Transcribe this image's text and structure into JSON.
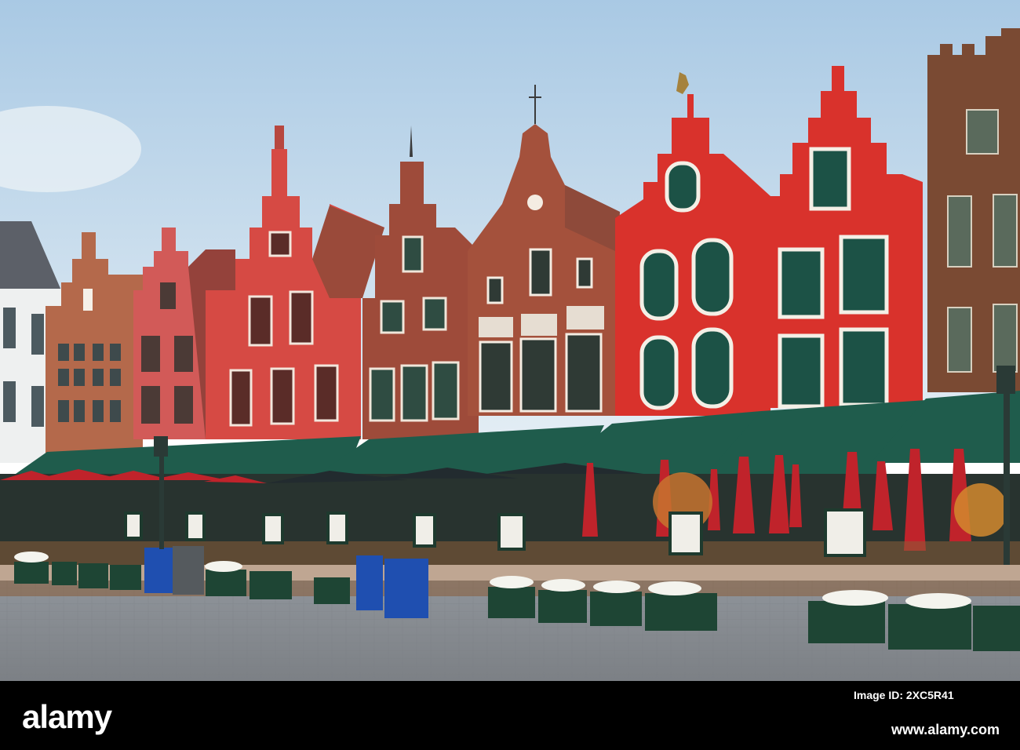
{
  "colors": {
    "sky_top": "#a9c9e4",
    "sky_bottom": "#dde9f2",
    "brick_red": "#c8312b",
    "brick_brown": "#9a4a33",
    "awning_green": "#1f5c4c",
    "umbrella_red": "#c0232b",
    "bin_blue": "#1f4fb0",
    "cobblestone": "#8e9196",
    "bar_black": "#000000"
  },
  "icons": [
    "weathervane-icon",
    "rooster-statue-icon"
  ],
  "watermark": {
    "brand": "alamy",
    "image_id": "Image ID: 2XC5R41",
    "url": "www.alamy.com"
  }
}
